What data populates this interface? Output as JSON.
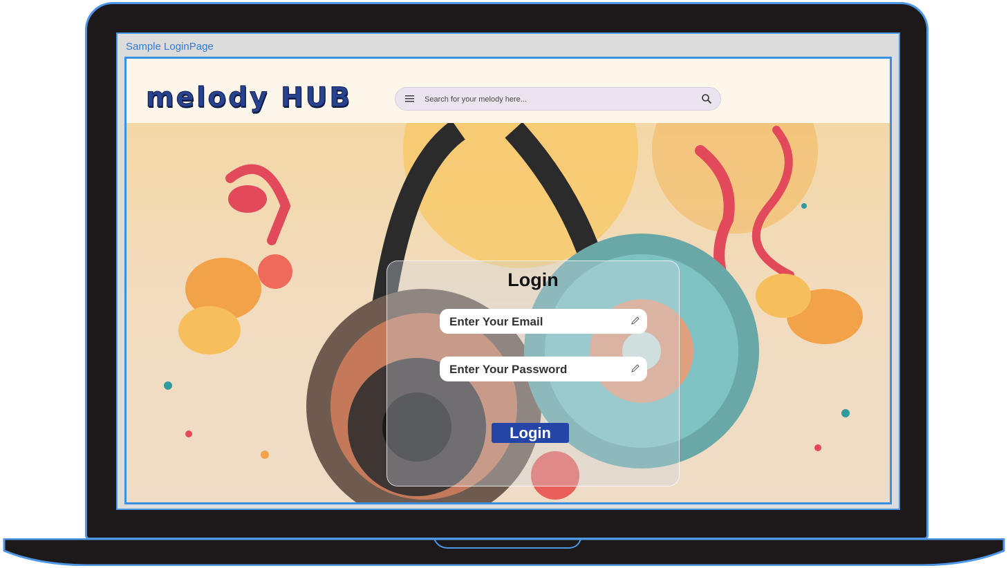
{
  "window": {
    "tab_title": "Sample LoginPage"
  },
  "header": {
    "logo": "melody HUB"
  },
  "search": {
    "placeholder": "Search for your melody here..."
  },
  "login": {
    "title": "Login",
    "email_placeholder": "Enter Your Email",
    "password_placeholder": "Enter Your Password",
    "button_label": "Login"
  },
  "icons": {
    "menu": "menu-icon",
    "search": "search-icon",
    "edit": "pencil-icon"
  },
  "colors": {
    "frame_border": "#4d97e6",
    "laptop_body": "#1d181a",
    "logo": "#27428f",
    "button": "#2445a6",
    "tab_title": "#2f7bd0"
  }
}
